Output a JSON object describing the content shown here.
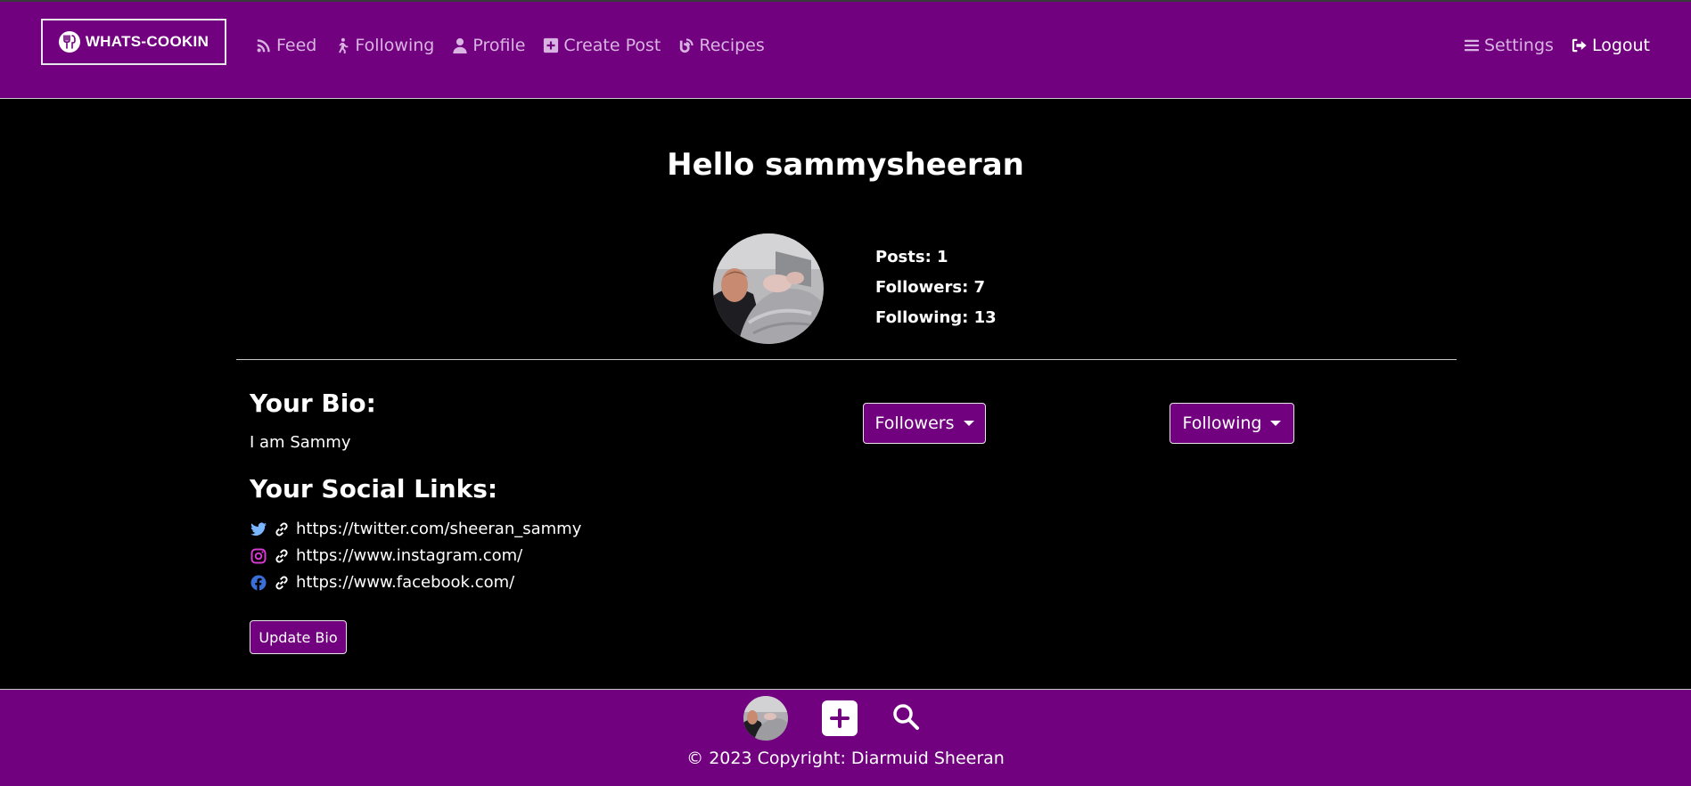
{
  "nav": {
    "brand": "WHATS-COOKIN",
    "links": [
      {
        "label": "Feed",
        "icon": "rss-icon"
      },
      {
        "label": "Following",
        "icon": "walking-person-icon"
      },
      {
        "label": "Profile",
        "icon": "user-icon"
      },
      {
        "label": "Create Post",
        "icon": "plus-square-icon"
      },
      {
        "label": "Recipes",
        "icon": "blog-icon"
      }
    ],
    "settings_label": "Settings",
    "logout_label": "Logout"
  },
  "profile": {
    "greeting": "Hello sammysheeran",
    "stats": {
      "posts": "Posts: 1",
      "followers": "Followers: 7",
      "following": "Following: 13"
    },
    "bio_heading": "Your Bio:",
    "bio_text": "I am Sammy",
    "social_heading": "Your Social Links:",
    "social_links": [
      {
        "icon": "twitter-icon",
        "url": "https://twitter.com/sheeran_sammy"
      },
      {
        "icon": "instagram-icon",
        "url": "https://www.instagram.com/"
      },
      {
        "icon": "facebook-icon",
        "url": "https://www.facebook.com/"
      }
    ],
    "update_bio_label": "Update Bio",
    "followers_dropdown_label": "Followers",
    "following_dropdown_label": "Following"
  },
  "footer": {
    "copyright": "© 2023 Copyright: Diarmuid Sheeran"
  },
  "colors": {
    "brand_purple": "#71017f",
    "background": "#000000",
    "nav_link": "#d9b3e2",
    "twitter": "#7ab5ff",
    "instagram": "#d63ad0",
    "facebook": "#3b6fd8"
  }
}
